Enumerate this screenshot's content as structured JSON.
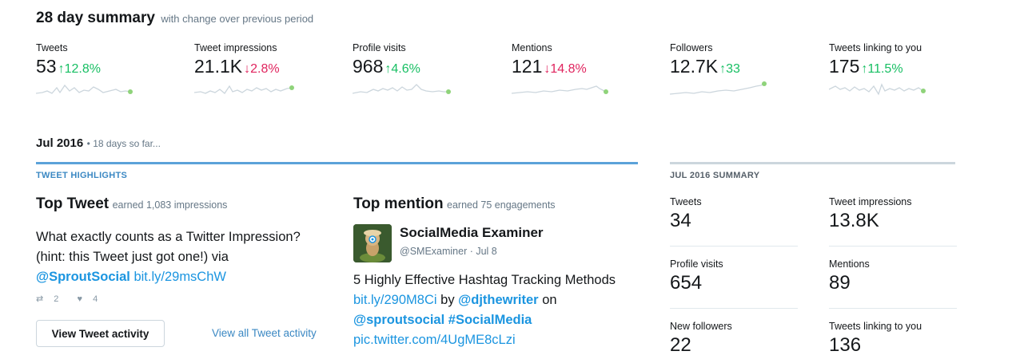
{
  "summary": {
    "title": "28 day summary",
    "subtitle": "with change over previous period"
  },
  "metrics": [
    {
      "label": "Tweets",
      "value": "53",
      "change": "12.8%",
      "dir": "up"
    },
    {
      "label": "Tweet impressions",
      "value": "21.1K",
      "change": "2.8%",
      "dir": "down"
    },
    {
      "label": "Profile visits",
      "value": "968",
      "change": "4.6%",
      "dir": "up"
    },
    {
      "label": "Mentions",
      "value": "121",
      "change": "14.8%",
      "dir": "down"
    },
    {
      "label": "Followers",
      "value": "12.7K",
      "change": "33",
      "dir": "up"
    },
    {
      "label": "Tweets linking to you",
      "value": "175",
      "change": "11.5%",
      "dir": "up"
    }
  ],
  "month": {
    "title": "Jul 2016",
    "subtitle": "18 days so far..."
  },
  "highlights": {
    "label": "TWEET HIGHLIGHTS",
    "top_tweet": {
      "title": "Top Tweet",
      "subtitle": "earned 1,083 impressions",
      "text": "What exactly counts as a Twitter Impression? (hint: this Tweet just got one!) via",
      "mention": "@SproutSocial",
      "link": "bit.ly/29msChW",
      "retweets": "2",
      "likes": "4",
      "button": "View Tweet activity",
      "all_link": "View all Tweet activity"
    },
    "top_mention": {
      "title": "Top mention",
      "subtitle": "earned 75 engagements",
      "name": "SocialMedia Examiner",
      "handle": "@SMExaminer",
      "date": "Jul 8",
      "text": "5 Highly Effective Hashtag Tracking Methods",
      "link1": "bit.ly/290M8Ci",
      "by": "by",
      "mention1": "@djthewriter",
      "on": "on",
      "mention2": "@sproutsocial",
      "hashtag": "#SocialMedia",
      "link2": "pic.twitter.com/4UgME8cLzi"
    }
  },
  "month_summary": {
    "label": "JUL 2016 SUMMARY",
    "items": [
      {
        "label": "Tweets",
        "value": "34"
      },
      {
        "label": "Tweet impressions",
        "value": "13.8K"
      },
      {
        "label": "Profile visits",
        "value": "654"
      },
      {
        "label": "Mentions",
        "value": "89"
      },
      {
        "label": "New followers",
        "value": "22"
      },
      {
        "label": "Tweets linking to you",
        "value": "136"
      }
    ]
  },
  "colors": {
    "up": "#17bf63",
    "down": "#e0245e",
    "link": "#1b95e0",
    "spark": "#ccd6dd",
    "dot": "#8fd37a"
  }
}
